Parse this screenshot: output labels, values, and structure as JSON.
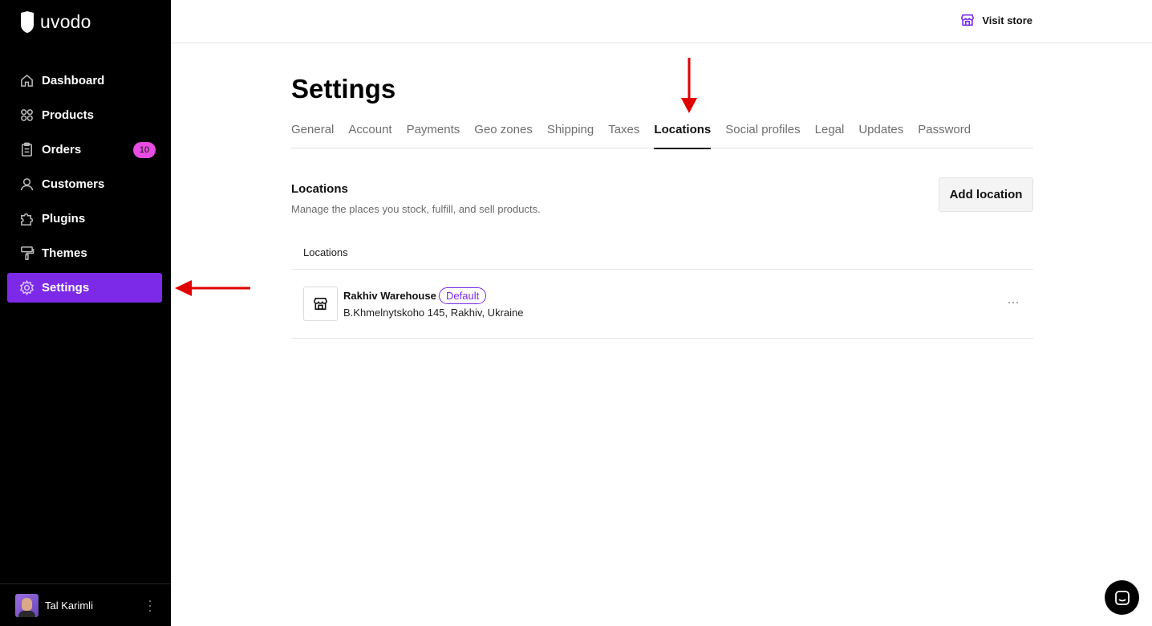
{
  "brand": {
    "name": "uvodo"
  },
  "sidebar": {
    "items": [
      {
        "label": "Dashboard",
        "icon": "home-icon"
      },
      {
        "label": "Products",
        "icon": "grid-icon"
      },
      {
        "label": "Orders",
        "icon": "clipboard-icon",
        "badge": "10"
      },
      {
        "label": "Customers",
        "icon": "user-icon"
      },
      {
        "label": "Plugins",
        "icon": "puzzle-icon"
      },
      {
        "label": "Themes",
        "icon": "paint-roller-icon"
      },
      {
        "label": "Settings",
        "icon": "gear-icon",
        "active": true
      }
    ],
    "user": {
      "name": "Tal Karimli"
    }
  },
  "header": {
    "visit_store_label": "Visit store",
    "icon": "storefront-icon"
  },
  "main": {
    "title": "Settings",
    "tabs": [
      {
        "label": "General"
      },
      {
        "label": "Account"
      },
      {
        "label": "Payments"
      },
      {
        "label": "Geo zones"
      },
      {
        "label": "Shipping"
      },
      {
        "label": "Taxes"
      },
      {
        "label": "Locations",
        "active": true
      },
      {
        "label": "Social profiles"
      },
      {
        "label": "Legal"
      },
      {
        "label": "Updates"
      },
      {
        "label": "Password"
      }
    ],
    "section": {
      "title": "Locations",
      "description": "Manage the places you stock, fulfill, and sell products.",
      "add_button_label": "Add location"
    },
    "table": {
      "header": "Locations",
      "rows": [
        {
          "name": "Rakhiv Warehouse",
          "badge": "Default",
          "address": "B.Khmelnytskoho 145, Rakhiv, Ukraine"
        }
      ]
    }
  },
  "colors": {
    "accent": "#7c2ae8",
    "badge": "#e84ce0",
    "sidebar_bg": "#000000",
    "annotation": "#e00000"
  }
}
